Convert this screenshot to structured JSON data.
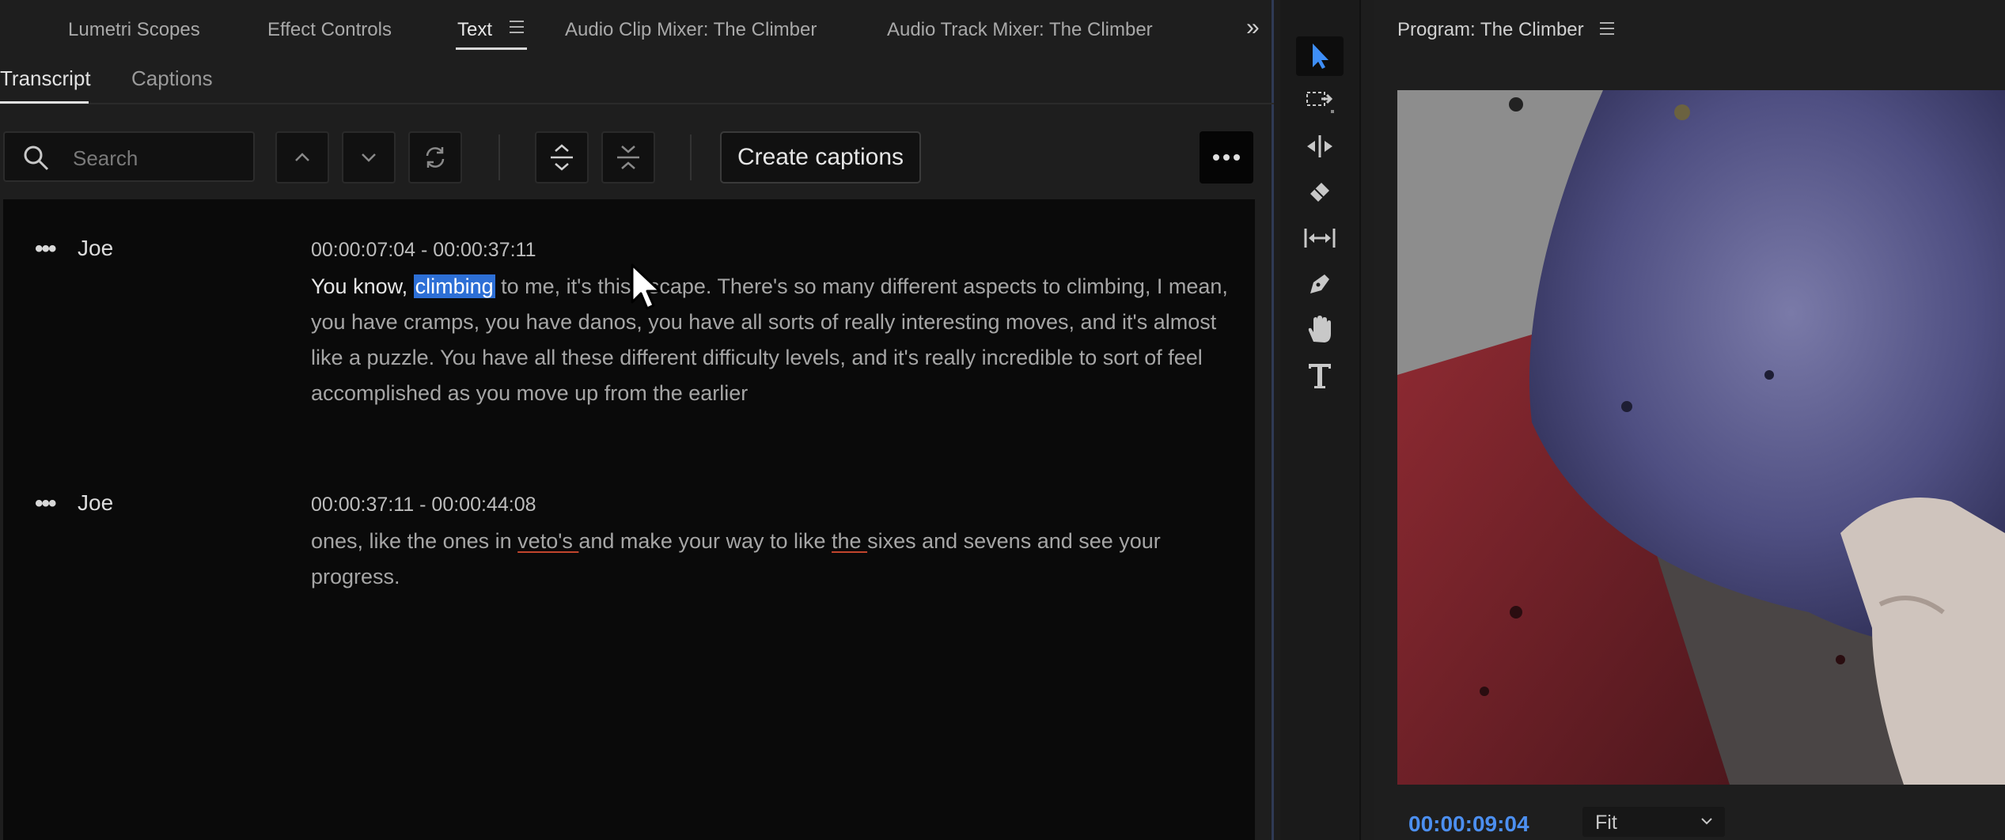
{
  "panel_tabs": [
    {
      "label": "Lumetri Scopes"
    },
    {
      "label": "Effect Controls"
    },
    {
      "label": "Text"
    },
    {
      "label": "Audio Clip Mixer: The Climber"
    },
    {
      "label": "Audio Track Mixer: The Climber"
    }
  ],
  "subtabs": {
    "transcript": "Transcript",
    "captions": "Captions"
  },
  "search": {
    "placeholder": "Search"
  },
  "toolbar": {
    "create_captions_label": "Create captions"
  },
  "transcript": [
    {
      "speaker": "Joe",
      "time": "00:00:07:04 - 00:00:37:11",
      "spoken": "You know, ",
      "highlight": "climbing",
      "rest": " to me, it's this escape. There's so many different aspects to climbing, I mean, you have cramps, you have danos, you have all sorts of really interesting moves, and it's almost like a puzzle. You have all these different difficulty levels, and it's really incredible to sort of feel accomplished as you move up from the earlier"
    },
    {
      "speaker": "Joe",
      "time": "00:00:37:11 - 00:00:44:08",
      "part1": "ones, like the ones in ",
      "flag1": "veto's ",
      "part2": "and make your way to like ",
      "flag2": "the ",
      "part3": "sixes and sevens and see your progress."
    }
  ],
  "program": {
    "title": "Program: The Climber",
    "timecode": "00:00:09:04",
    "fit": "Fit"
  },
  "colors": {
    "accent": "#2d6fd6",
    "timecode": "#4c8ff0",
    "panel_border": "#2f3a55"
  }
}
